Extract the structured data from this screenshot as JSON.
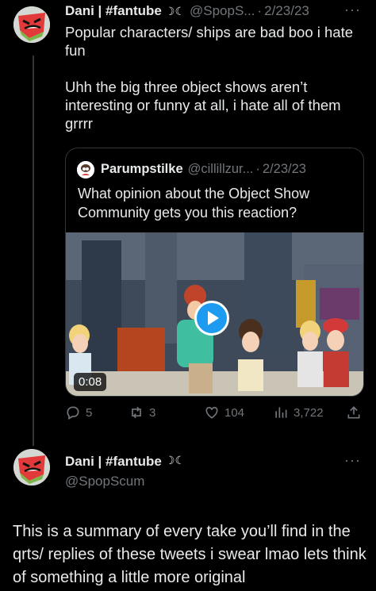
{
  "tweet": {
    "display_name": "Dani | #fantube",
    "moon": "☽☾",
    "handle": "@SpopS...",
    "date": "2/23/23",
    "more": "···",
    "paragraphs": [
      "Popular characters/ ships are bad boo i hate fun",
      "Uhh the big three object shows aren’t interesting or funny at all, i hate all of them grrrr"
    ],
    "quote": {
      "display_name": "Parumpstilke",
      "handle": "@cillillzur...",
      "date": "2/23/23",
      "text": "What opinion about the Object Show Community gets you this reaction?",
      "video": {
        "duration": "0:08"
      }
    },
    "actions": {
      "replies": "5",
      "retweets": "3",
      "likes": "104",
      "views": "3,722"
    }
  },
  "reply": {
    "display_name": "Dani | #fantube",
    "moon": "☽☾",
    "handle": "@SpopScum",
    "more": "···",
    "text": "This is a summary of every take you’ll find in the qrts/ replies of these tweets i swear lmao lets think of something a little more original"
  }
}
